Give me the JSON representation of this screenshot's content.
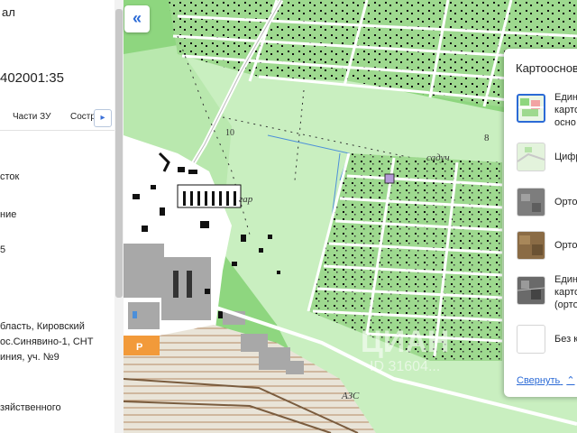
{
  "left_panel": {
    "heading": "ал",
    "cadastral_number": "402001:35",
    "tabs": [
      "Части ЗУ",
      "Состр"
    ],
    "rows": [
      "сток",
      "ние",
      "5"
    ],
    "address_lines": [
      "бласть, Кировский",
      "ос.Синявино-1, СНТ",
      "иния, уч. №9"
    ],
    "footer": "зяйственного"
  },
  "map": {
    "labels": {
      "quarter_10": "10",
      "quarter_8": "8",
      "sadovod": "садуч",
      "garage": "гар",
      "gas_station": "АЗС",
      "parking": "P"
    },
    "watermark": "ЦИАН",
    "watermark_id": "ID 31604..."
  },
  "layers_panel": {
    "title": "Картооснова",
    "items": [
      {
        "label_lines": [
          "Един",
          "карто",
          "осно"
        ],
        "icon": "map-scheme-icon",
        "selected": true
      },
      {
        "label_lines": [
          "Цифр"
        ],
        "icon": "digital-map-icon",
        "selected": false
      },
      {
        "label_lines": [
          "Орто"
        ],
        "icon": "orthophoto-gray-icon",
        "selected": false
      },
      {
        "label_lines": [
          "Орто"
        ],
        "icon": "orthophoto-color-icon",
        "selected": false
      },
      {
        "label_lines": [
          "Един",
          "карто",
          "(орто"
        ],
        "icon": "orthophoto-satellite-icon",
        "selected": false
      },
      {
        "label_lines": [
          "Без к"
        ],
        "icon": "no-basemap-icon",
        "selected": false
      }
    ],
    "collapse_link": "Свернуть",
    "accent_color": "#2b6ad6"
  },
  "colors": {
    "map_green": "#8ed67f",
    "map_light_green": "#c9efc0",
    "road_white": "#ffffff",
    "building_black": "#111111",
    "building_gray": "#a8a8a8",
    "parking_orange": "#f29a3a",
    "water_blue": "#4c8fd9"
  }
}
